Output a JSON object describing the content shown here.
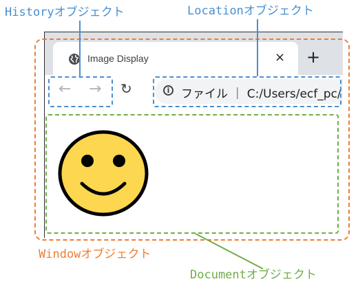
{
  "labels": {
    "history": "Historyオブジェクト",
    "location": "Locationオブジェクト",
    "window": "Windowオブジェクト",
    "document": "Documentオブジェクト"
  },
  "browser": {
    "tab_title": "Image Display",
    "tab_close": "×",
    "new_tab": "+",
    "back": "←",
    "forward": "→",
    "reload": "↻",
    "info": "i",
    "address": "ファイル ｜ C:/Users/ecf_pc/"
  },
  "colors": {
    "history": "#4a8ed0",
    "location": "#4a8ed0",
    "window": "#ee7d31",
    "document": "#70ad47",
    "smiley": "#fcd74f"
  },
  "icons": {
    "globe": "globe-icon",
    "smiley": "smiley-face-icon"
  }
}
